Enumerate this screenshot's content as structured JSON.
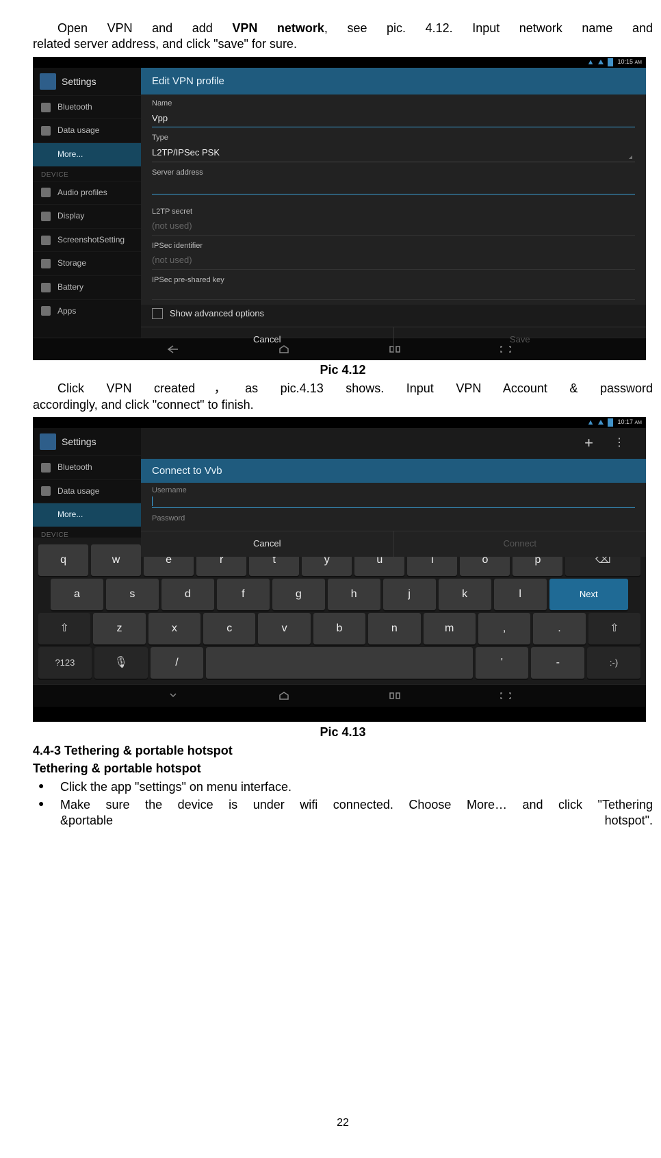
{
  "para1_a": "Open VPN and add ",
  "para1_b": "VPN network",
  "para1_c": ", see pic. 4.12. Input network name and",
  "para1_line2": "related server address, and click \"save\" for sure.",
  "caption1": "Pic 4.12",
  "para2_line1": "Click VPN created，as pic.4.13 shows. Input VPN Account & password",
  "para2_line2": "accordingly, and click \"connect\" to finish.",
  "caption2": "Pic 4.13",
  "sec_num": "4.4-3 Tethering & portable hotspot",
  "sec_sub": "Tethering & portable hotspot",
  "bul1": "Click the app \"settings\" on menu interface.",
  "bul2_a": " Make sure the device is under wifi connected. Choose More… and click \"Tethering",
  "bul2_b_left": "&portable",
  "bul2_b_right": "hotspot\".",
  "page": "22",
  "shot1": {
    "time": "10:15",
    "am": "AM",
    "settings": "Settings",
    "sb": {
      "bt": "Bluetooth",
      "du": "Data usage",
      "more": "More...",
      "device": "DEVICE",
      "ap": "Audio profiles",
      "dis": "Display",
      "ss": "ScreenshotSetting",
      "st": "Storage",
      "bat": "Battery",
      "apps": "Apps"
    },
    "dlg": {
      "title": "Edit VPN profile",
      "name_l": "Name",
      "name_v": "Vpp",
      "type_l": "Type",
      "type_v": "L2TP/IPSec PSK",
      "srv_l": "Server address",
      "l2tp_l": "L2TP secret",
      "l2tp_v": "(not used)",
      "ipid_l": "IPSec identifier",
      "ipid_v": "(not used)",
      "psk_l": "IPSec pre-shared key",
      "adv": "Show advanced options",
      "cancel": "Cancel",
      "save": "Save"
    }
  },
  "shot2": {
    "time": "10:17",
    "am": "AM",
    "settings": "Settings",
    "sb": {
      "bt": "Bluetooth",
      "du": "Data usage",
      "more": "More...",
      "device": "DEVICE"
    },
    "dlg": {
      "title": "Connect to Vvb",
      "user_l": "Username",
      "pass_l": "Password",
      "cancel": "Cancel",
      "connect": "Connect"
    },
    "kb": {
      "r1": [
        "q",
        "w",
        "e",
        "r",
        "t",
        "y",
        "u",
        "i",
        "o",
        "p"
      ],
      "r2": [
        "a",
        "s",
        "d",
        "f",
        "g",
        "h",
        "j",
        "k",
        "l"
      ],
      "r3": [
        "z",
        "x",
        "c",
        "v",
        "b",
        "n",
        "m",
        ",",
        "."
      ],
      "next": "Next",
      "sym": "?123",
      "slash": "/",
      "apos": "'",
      "dash": "-",
      "smile": ":-)",
      "bksp": "⌫",
      "shift": "⇧",
      "mic": "🎤"
    }
  }
}
